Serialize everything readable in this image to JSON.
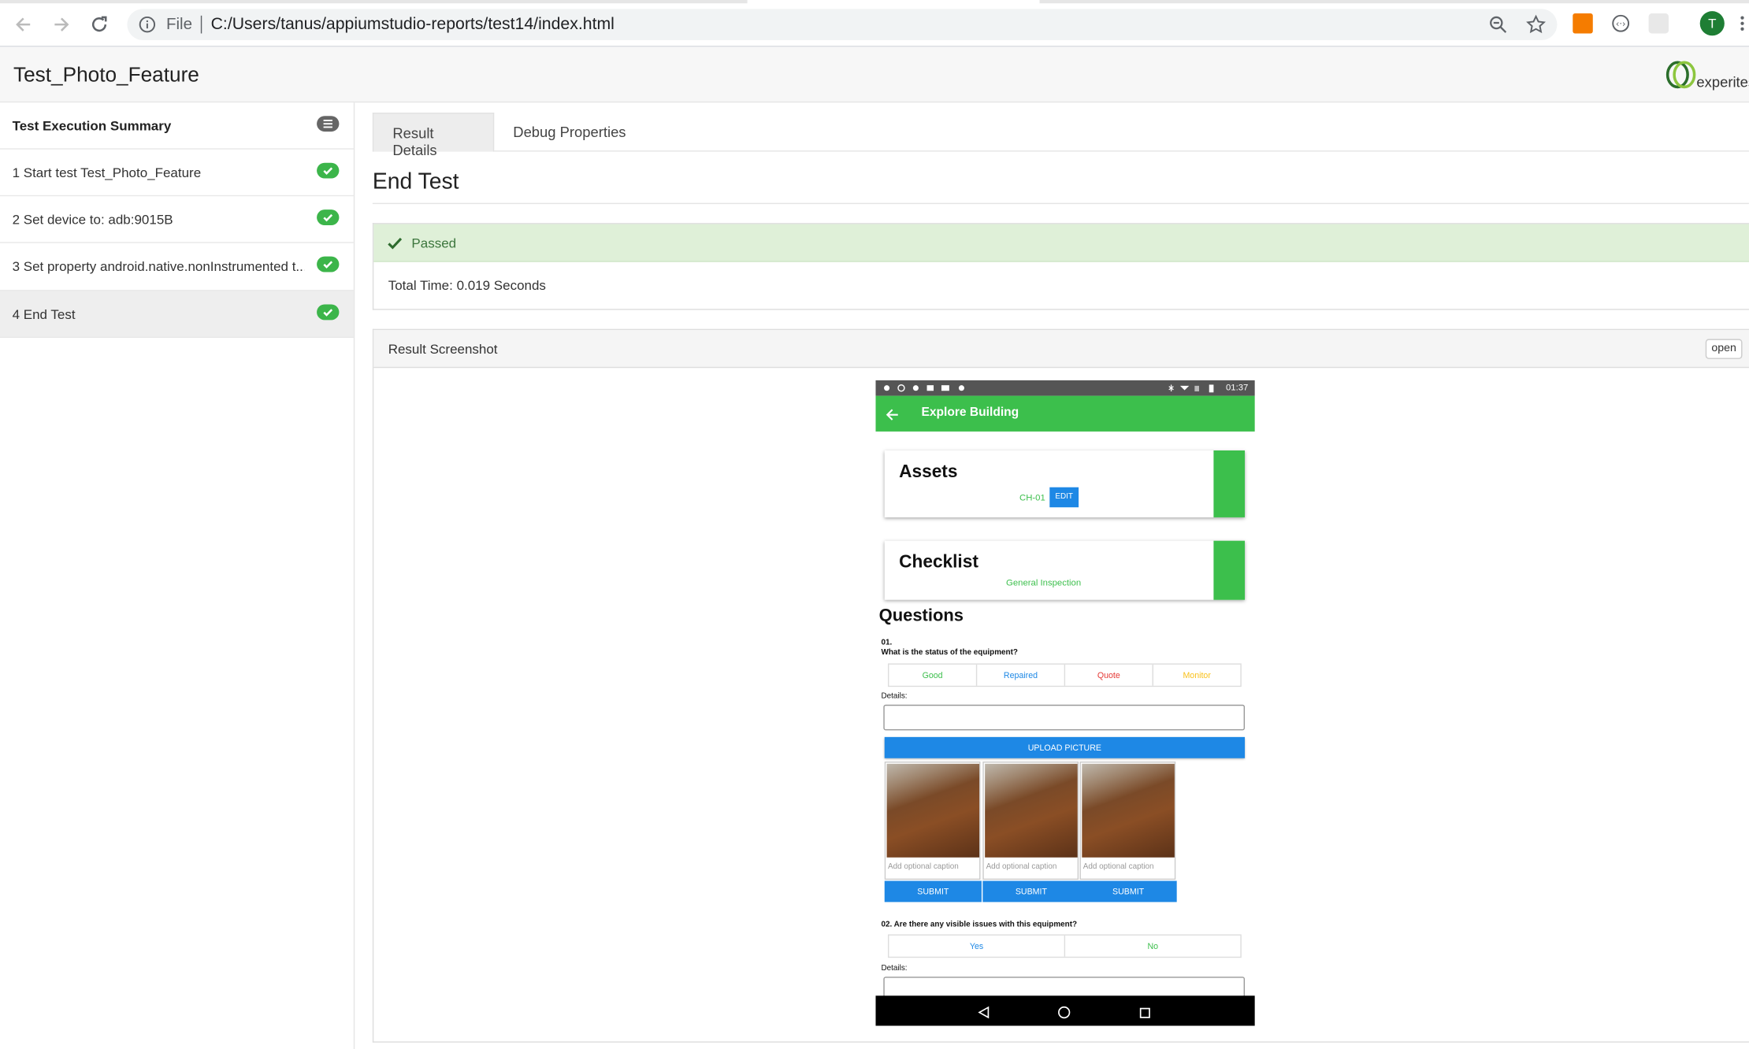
{
  "browser": {
    "file_label": "File",
    "url": "C:/Users/tanus/appiumstudio-reports/test14/index.html",
    "profile_initial": "T"
  },
  "header": {
    "title": "Test_Photo_Feature",
    "logo_text": "experitest"
  },
  "sidebar": {
    "summary_label": "Test Execution Summary",
    "items": [
      {
        "label": "1 Start test Test_Photo_Feature",
        "status": "passed"
      },
      {
        "label": "2 Set device to: adb:9015B",
        "status": "passed"
      },
      {
        "label": "3 Set property android.native.nonInstrumented t...",
        "status": "passed"
      },
      {
        "label": "4 End Test",
        "status": "passed"
      }
    ]
  },
  "main": {
    "tabs": [
      {
        "label": "Result Details"
      },
      {
        "label": "Debug Properties"
      }
    ],
    "step_title": "End Test",
    "status_text": "Passed",
    "total_time": "Total Time: 0.019 Seconds",
    "screenshot_title": "Result Screenshot",
    "open_label": "open"
  },
  "phone": {
    "clock": "01:37",
    "app_title": "Explore Building",
    "assets_title": "Assets",
    "asset_code": "CH-01",
    "edit_label": "EDIT",
    "checklist_title": "Checklist",
    "checklist_name": "General Inspection",
    "questions_title": "Questions",
    "q1_number": "01.",
    "q1_text": "What is the status of the equipment?",
    "q1_options": [
      "Good",
      "Repaired",
      "Quote",
      "Monitor"
    ],
    "details_label": "Details:",
    "upload_label": "UPLOAD PICTURE",
    "caption_placeholder": "Add optional caption",
    "submit_label": "SUBMIT",
    "q2_text": "02. Are there any visible issues with this equipment?",
    "q2_options": [
      "Yes",
      "No"
    ]
  },
  "colors": {
    "success": "#3cb54a",
    "app_green": "#3cbf4c",
    "primary_blue": "#1e88e5",
    "passed_bg": "#dff0d8"
  }
}
